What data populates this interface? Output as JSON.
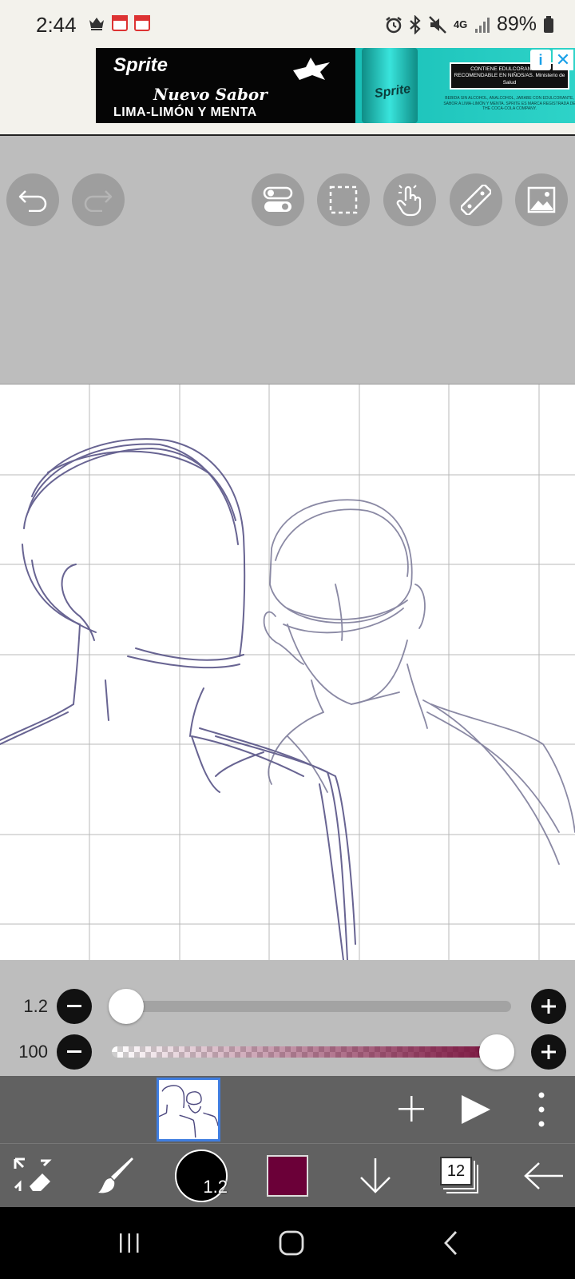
{
  "status_bar": {
    "time": "2:44",
    "network": "4G",
    "battery": "89%",
    "left_icons": [
      "crown-icon",
      "calendar-icon",
      "calendar-icon"
    ],
    "right_icons": [
      "alarm-icon",
      "bluetooth-icon",
      "mute-icon",
      "signal-icon",
      "battery-icon"
    ]
  },
  "ad": {
    "brand": "Sprite",
    "line1": "Nuevo Sabor",
    "line2": "LIMA-LIMÓN Y MENTA",
    "can_label": "Sprite",
    "warning": "CONTIENE EDULCORANTE. NO RECOMENDABLE EN NIÑOS/AS. Ministerio de Salud",
    "fine_print": "BEBIDA SIN ALCOHOL, ANALCOHOL, JARABE CON EDULCORANTE, SABOR A LIMA-LIMÓN Y MENTA. SPRITE ES MARCA REGISTRADA DE THE COCA-COLA COMPANY.",
    "choices_icon": "i",
    "close_icon": "✕"
  },
  "top_tools": {
    "icons": [
      "undo-icon",
      "redo-icon",
      "toggle-icon",
      "selection-icon",
      "hand-icon",
      "ruler-icon",
      "image-icon"
    ]
  },
  "brush": {
    "size_label": "1.2",
    "size_fraction": 0.0,
    "opacity_label": "100",
    "opacity_fraction": 1.0,
    "color": "#6b0038"
  },
  "frames": {
    "add_label": "+",
    "icons": [
      "add-frame-icon",
      "play-icon",
      "more-vertical-icon"
    ]
  },
  "toolbar": {
    "brush_size": "1.2",
    "layer_count": "12",
    "icons": [
      "transform-eraser-icon",
      "brush-icon",
      "brush-size-icon",
      "color-swatch",
      "download-icon",
      "layers-icon",
      "back-arrow-icon"
    ]
  },
  "nav": {
    "icons": [
      "recents-icon",
      "home-icon",
      "back-icon"
    ]
  }
}
